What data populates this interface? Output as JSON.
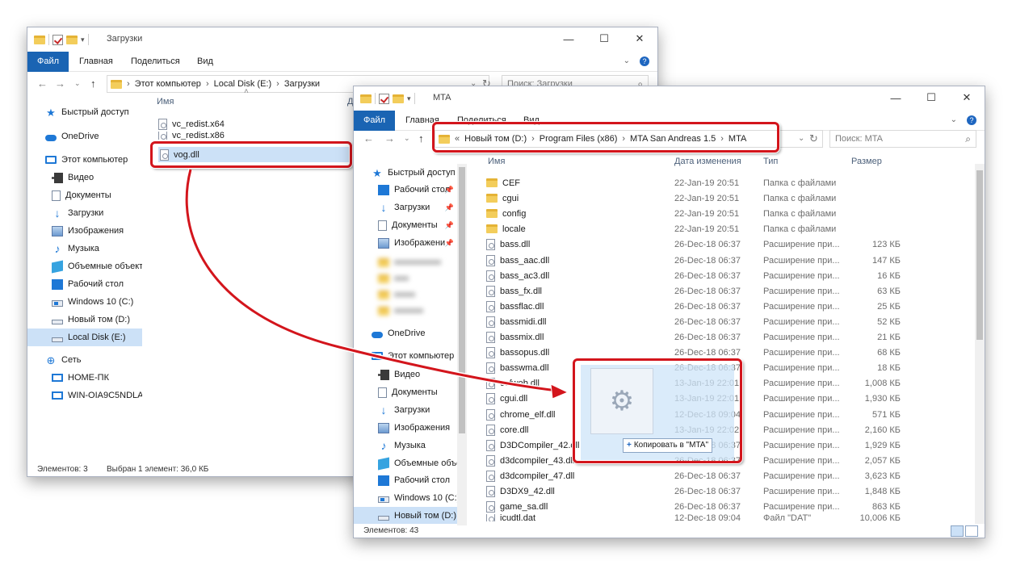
{
  "win1": {
    "title": "Загрузки",
    "tabs": [
      "Файл",
      "Главная",
      "Поделиться",
      "Вид"
    ],
    "address": [
      "Этот компьютер",
      "Local Disk (E:)",
      "Загрузки"
    ],
    "search_placeholder": "Поиск: Загрузки",
    "col_name": "Имя",
    "col_trunc": "Д",
    "files": [
      "vc_redist.x64",
      "vc_redist.x86",
      "vog.dll"
    ],
    "sidebar": [
      {
        "label": "Быстрый доступ",
        "icon": "star-icon"
      },
      {
        "label": "OneDrive",
        "icon": "cloud-icon"
      },
      {
        "label": "Этот компьютер",
        "icon": "pc-icon"
      },
      {
        "label": "Видео",
        "icon": "video-icon"
      },
      {
        "label": "Документы",
        "icon": "documents-icon"
      },
      {
        "label": "Загрузки",
        "icon": "download-icon"
      },
      {
        "label": "Изображения",
        "icon": "images-icon"
      },
      {
        "label": "Музыка",
        "icon": "music-icon"
      },
      {
        "label": "Объемные объекты",
        "icon": "3d-objects-icon"
      },
      {
        "label": "Рабочий стол",
        "icon": "desktop-icon"
      },
      {
        "label": "Windows 10 (C:)",
        "icon": "windows-drive-icon"
      },
      {
        "label": "Новый том (D:)",
        "icon": "drive-icon"
      },
      {
        "label": "Local Disk (E:)",
        "icon": "drive-icon"
      },
      {
        "label": "Сеть",
        "icon": "network-icon"
      },
      {
        "label": "HOME-ПК",
        "icon": "monitor-icon"
      },
      {
        "label": "WIN-OIA9C5NDLAN",
        "icon": "monitor-icon"
      }
    ],
    "status_count": "Элементов: 3",
    "status_selected": "Выбран 1 элемент: 36,0 КБ"
  },
  "win2": {
    "title": "MTA",
    "tabs": [
      "Файл",
      "Главная",
      "Поделиться",
      "Вид"
    ],
    "address": [
      "«",
      "Новый том (D:)",
      "Program Files (x86)",
      "MTA San Andreas 1.5",
      "MTA"
    ],
    "search_placeholder": "Поиск: MTA",
    "columns": {
      "name": "Имя",
      "date": "Дата изменения",
      "type": "Тип",
      "size": "Размер"
    },
    "sidebar": [
      {
        "label": "Быстрый доступ",
        "icon": "star-icon"
      },
      {
        "label": "Рабочий стол",
        "icon": "desktop-icon"
      },
      {
        "label": "Загрузки",
        "icon": "download-icon"
      },
      {
        "label": "Документы",
        "icon": "documents-icon"
      },
      {
        "label": "Изображени",
        "icon": "images-icon"
      },
      {
        "label": "OneDrive",
        "icon": "cloud-icon"
      },
      {
        "label": "Этот компьютер",
        "icon": "pc-icon"
      },
      {
        "label": "Видео",
        "icon": "video-icon"
      },
      {
        "label": "Документы",
        "icon": "documents-icon"
      },
      {
        "label": "Загрузки",
        "icon": "download-icon"
      },
      {
        "label": "Изображения",
        "icon": "images-icon"
      },
      {
        "label": "Музыка",
        "icon": "music-icon"
      },
      {
        "label": "Объемные объекты",
        "icon": "3d-objects-icon"
      },
      {
        "label": "Рабочий стол",
        "icon": "desktop-icon"
      },
      {
        "label": "Windows 10 (C:)",
        "icon": "windows-drive-icon"
      },
      {
        "label": "Новый том (D:)",
        "icon": "drive-icon"
      }
    ],
    "files": [
      {
        "name": "CEF",
        "date": "22-Jan-19 20:51",
        "type": "Папка с файлами",
        "size": "",
        "kind": "folder"
      },
      {
        "name": "cgui",
        "date": "22-Jan-19 20:51",
        "type": "Папка с файлами",
        "size": "",
        "kind": "folder"
      },
      {
        "name": "config",
        "date": "22-Jan-19 20:51",
        "type": "Папка с файлами",
        "size": "",
        "kind": "folder"
      },
      {
        "name": "locale",
        "date": "22-Jan-19 20:51",
        "type": "Папка с файлами",
        "size": "",
        "kind": "folder"
      },
      {
        "name": "bass.dll",
        "date": "26-Dec-18 06:37",
        "type": "Расширение при...",
        "size": "123 КБ",
        "kind": "file"
      },
      {
        "name": "bass_aac.dll",
        "date": "26-Dec-18 06:37",
        "type": "Расширение при...",
        "size": "147 КБ",
        "kind": "file"
      },
      {
        "name": "bass_ac3.dll",
        "date": "26-Dec-18 06:37",
        "type": "Расширение при...",
        "size": "16 КБ",
        "kind": "file"
      },
      {
        "name": "bass_fx.dll",
        "date": "26-Dec-18 06:37",
        "type": "Расширение при...",
        "size": "63 КБ",
        "kind": "file"
      },
      {
        "name": "bassflac.dll",
        "date": "26-Dec-18 06:37",
        "type": "Расширение при...",
        "size": "25 КБ",
        "kind": "file"
      },
      {
        "name": "bassmidi.dll",
        "date": "26-Dec-18 06:37",
        "type": "Расширение при...",
        "size": "52 КБ",
        "kind": "file"
      },
      {
        "name": "bassmix.dll",
        "date": "26-Dec-18 06:37",
        "type": "Расширение при...",
        "size": "21 КБ",
        "kind": "file"
      },
      {
        "name": "bassopus.dll",
        "date": "26-Dec-18 06:37",
        "type": "Расширение при...",
        "size": "68 КБ",
        "kind": "file"
      },
      {
        "name": "basswma.dll",
        "date": "26-Dec-18 06:37",
        "type": "Расширение при...",
        "size": "18 КБ",
        "kind": "file"
      },
      {
        "name": "cefweb.dll",
        "date": "13-Jan-19 22:01",
        "type": "Расширение при...",
        "size": "1,008 КБ",
        "kind": "file"
      },
      {
        "name": "cgui.dll",
        "date": "13-Jan-19 22:01",
        "type": "Расширение при...",
        "size": "1,930 КБ",
        "kind": "file"
      },
      {
        "name": "chrome_elf.dll",
        "date": "12-Dec-18 09:04",
        "type": "Расширение при...",
        "size": "571 КБ",
        "kind": "file"
      },
      {
        "name": "core.dll",
        "date": "13-Jan-19 22:02",
        "type": "Расширение при...",
        "size": "2,160 КБ",
        "kind": "file"
      },
      {
        "name": "D3DCompiler_42.dll",
        "date": "26-Dec-18 06:37",
        "type": "Расширение при...",
        "size": "1,929 КБ",
        "kind": "file"
      },
      {
        "name": "d3dcompiler_43.dll",
        "date": "26-Dec-18 06:37",
        "type": "Расширение при...",
        "size": "2,057 КБ",
        "kind": "file"
      },
      {
        "name": "d3dcompiler_47.dll",
        "date": "26-Dec-18 06:37",
        "type": "Расширение при...",
        "size": "3,623 КБ",
        "kind": "file"
      },
      {
        "name": "D3DX9_42.dll",
        "date": "26-Dec-18 06:37",
        "type": "Расширение при...",
        "size": "1,848 КБ",
        "kind": "file"
      },
      {
        "name": "game_sa.dll",
        "date": "26-Dec-18 06:37",
        "type": "Расширение при...",
        "size": "863 КБ",
        "kind": "file"
      },
      {
        "name": "icudtl.dat",
        "date": "12-Dec-18 09:04",
        "type": "Файл \"DAT\"",
        "size": "10,006 КБ",
        "kind": "file"
      }
    ],
    "status_count": "Элементов: 43"
  },
  "drag": {
    "tooltip": "Копировать в \"MTA\""
  },
  "accent": "#1a64b3",
  "highlight": "#d3151c"
}
